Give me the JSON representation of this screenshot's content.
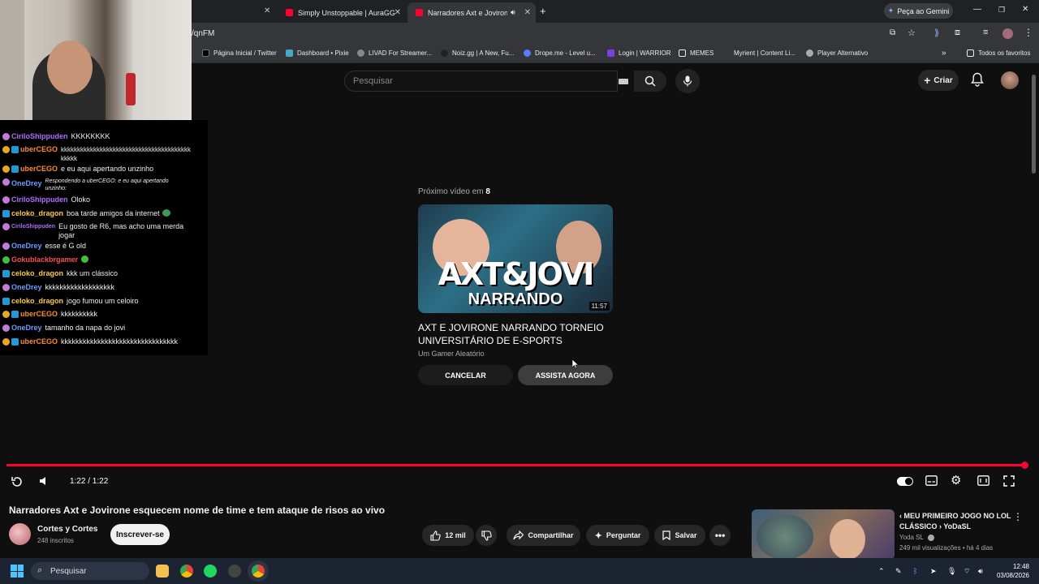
{
  "browser": {
    "tabs": [
      {
        "title": "Simply Unstoppable | AuraGG.c",
        "active": false
      },
      {
        "title": "Narradores Axt e Jovirone e",
        "active": true
      }
    ],
    "gemini_label": "Peça ao Gemini",
    "url": "/qnFM",
    "bookmarks": [
      "Página Inicial / Twitter",
      "Dashboard • Pixie",
      "LIVAD For Streamer...",
      "Noiz.gg | A New, Fu...",
      "Drope.me - Level u...",
      "Login | WARRIOR",
      "MEMES",
      "Myrient | Content Li...",
      "Player Alternativo"
    ],
    "all_bookmarks": "Todos os favoritos"
  },
  "youtube": {
    "search_placeholder": "Pesquisar",
    "create_label": "Criar"
  },
  "chat": [
    {
      "user": "CiriloShippuden",
      "color": "#b26cff",
      "text": "KKKKKKKK",
      "badge": "#c47ad8"
    },
    {
      "user": "uberCEGO",
      "color": "#ff8c1a",
      "text": "kkkkkkkkkkkkkkkkkkkkkkkkkkkkkkkkkkkkkkkk",
      "text2": "kkkkk",
      "badge": "#e6a91b"
    },
    {
      "user": "uberCEGO",
      "color": "#ff8c1a",
      "text": "e eu aqui apertando unzinho",
      "badge": "#e6a91b"
    },
    {
      "user": "OneDrey",
      "color": "#6b9cff",
      "reply": "Respondendo a uberCEGO: e eu aqui apertando",
      "reply2": "unzinho:",
      "badge": "#c47ad8"
    },
    {
      "user": "CiriloShippuden",
      "color": "#b26cff",
      "text": "Oloko",
      "badge": "#c47ad8"
    },
    {
      "user": "celoko_dragon",
      "color": "#ffcc33",
      "text": "boa tarde amigos da internet",
      "badge": "#1e9bd7"
    },
    {
      "user": "CiriloShippuden",
      "color": "#b26cff",
      "text": "Eu gosto de R6, mas acho uma merda",
      "text2": "jogar",
      "badge": "#c47ad8"
    },
    {
      "user": "OneDrey",
      "color": "#6b9cff",
      "text": "esse é G old",
      "badge": "#c47ad8"
    },
    {
      "user": "Gokublackbrgamer",
      "color": "#ff4d4d",
      "text": "",
      "badge": "#3fbf3f"
    },
    {
      "user": "celoko_dragon",
      "color": "#ffcc33",
      "text": "kkk um clássico",
      "badge": "#1e9bd7"
    },
    {
      "user": "OneDrey",
      "color": "#6b9cff",
      "text": "kkkkkkkkkkkkkkkkkkk",
      "badge": "#c47ad8"
    },
    {
      "user": "celoko_dragon",
      "color": "#ffcc33",
      "text": "jogo fumou um celoiro",
      "badge": "#1e9bd7"
    },
    {
      "user": "uberCEGO",
      "color": "#ff8c1a",
      "text": "kkkkkkkkkk",
      "badge": "#e6a91b"
    },
    {
      "user": "OneDrey",
      "color": "#6b9cff",
      "text": "tamanho da napa do jovi",
      "badge": "#c47ad8"
    },
    {
      "user": "uberCEGO",
      "color": "#ff8c1a",
      "text": "kkkkkkkkkkkkkkkkkkkkkkkkkkkkkkkk",
      "badge": "#e6a91b"
    }
  ],
  "endscreen": {
    "next_label": "Próximo vídeo em",
    "countdown": "8",
    "thumb_title": "AXT&JOVI",
    "thumb_sub": "NARRANDO",
    "duration": "11:57",
    "title": "AXT E JOVIRONE NARRANDO TORNEIO UNIVERSITÁRIO DE E-SPORTS",
    "channel": "Um Gamer Aleatório",
    "cancel": "CANCELAR",
    "watch": "ASSISTA AGORA"
  },
  "player": {
    "time": "1:22 / 1:22",
    "progress": 1.0
  },
  "video": {
    "title": "Narradores Axt e Jovirone esquecem nome de time e tem ataque de risos ao vivo",
    "channel": "Cortes y Cortes",
    "subscribers": "248 inscritos",
    "subscribe": "Inscrever-se",
    "likes": "12 mil",
    "share": "Compartilhar",
    "ask": "Perguntar",
    "save": "Salvar"
  },
  "recommended": {
    "title": "‹ MEU  PRIMEIRO JOGO NO LOL CLÁSSICO › YoDaSL",
    "channel": "Yoda SL",
    "stats": "249 mil visualizações • há 4 dias"
  },
  "taskbar": {
    "search": "Pesquisar",
    "time": "12:48",
    "date": "03/08/2026"
  }
}
